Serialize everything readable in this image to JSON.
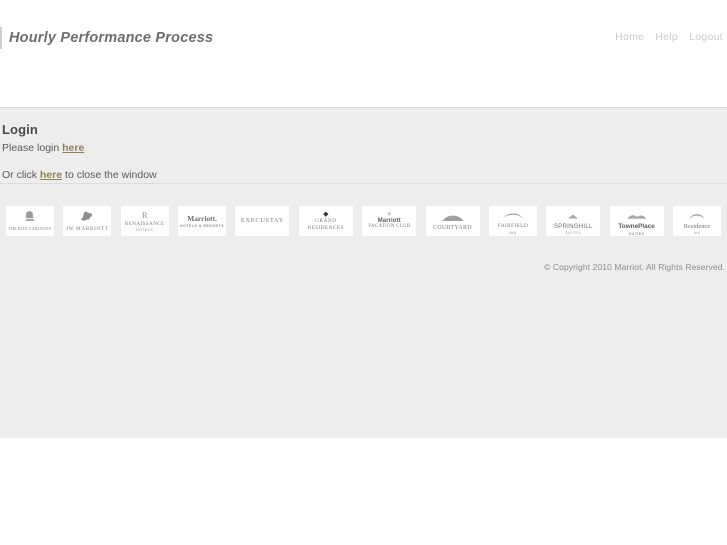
{
  "header": {
    "app_title": "Hourly Performance Process",
    "nav": [
      {
        "label": "Home"
      },
      {
        "label": "Help"
      },
      {
        "label": "Logout"
      }
    ]
  },
  "login": {
    "heading": "Login",
    "prompt_prefix": "Please login ",
    "prompt_link": "here",
    "close_prefix": "Or click ",
    "close_link": "here",
    "close_suffix": " to close the window"
  },
  "brands": [
    {
      "name": "The Ritz-Carlton",
      "mark": "lion-crest-icon",
      "glyph": "♜",
      "line1": "THE RITZ-CARLTON®",
      "line2": ""
    },
    {
      "name": "JW Marriott",
      "mark": "griffin-icon",
      "glyph": "❦",
      "line1": "JW MARRIOTT",
      "line2": ""
    },
    {
      "name": "Renaissance Hotels",
      "mark": "letter-r-icon",
      "glyph": "R",
      "line1": "RENAISSANCE",
      "line2": "HOTELS"
    },
    {
      "name": "Marriott Hotels & Resorts",
      "mark": "marriott-script-icon",
      "glyph": "",
      "line1": "Marriott.",
      "line2": "HOTELS & RESORTS"
    },
    {
      "name": "ExecuStay",
      "mark": "execustay-icon",
      "glyph": "",
      "line1": "EXECUSTAY",
      "line2": ""
    },
    {
      "name": "Grand Residences",
      "mark": "diamond-icon",
      "glyph": "◆",
      "line1": "GRAND",
      "line2": "RESIDENCES"
    },
    {
      "name": "Marriott Vacation Club",
      "mark": "sunburst-icon",
      "glyph": "☀",
      "line1": "Marriott",
      "line2": "VACATION CLUB"
    },
    {
      "name": "Courtyard",
      "mark": "arch-icon",
      "glyph": "⌂",
      "line1": "COURTYARD",
      "line2": ""
    },
    {
      "name": "Fairfield Inn",
      "mark": "roof-icon",
      "glyph": "⌒",
      "line1": "FAIRFIELD",
      "line2": "INN"
    },
    {
      "name": "SpringHill Suites",
      "mark": "peak-icon",
      "glyph": "▲",
      "line1": "SPRINGHILL",
      "line2": "SUITES"
    },
    {
      "name": "TownePlace Suites",
      "mark": "hills-icon",
      "glyph": "◠",
      "line1": "TownePlace",
      "line2": "SUITES"
    },
    {
      "name": "Residence Inn",
      "mark": "arc-icon",
      "glyph": "◠",
      "line1": "Residence",
      "line2": "Inn"
    }
  ],
  "footer": {
    "copyright": "© Copyright 2010 Marriot. All Rights Reserved."
  },
  "colors": {
    "page_background": "#ededed",
    "header_background": "#ffffff",
    "title_text": "#6e6e6e",
    "nav_text": "#cacaca",
    "link": "#8d8156",
    "divider": "#dcdcdc",
    "logo_gray": "#9a9a9a"
  }
}
